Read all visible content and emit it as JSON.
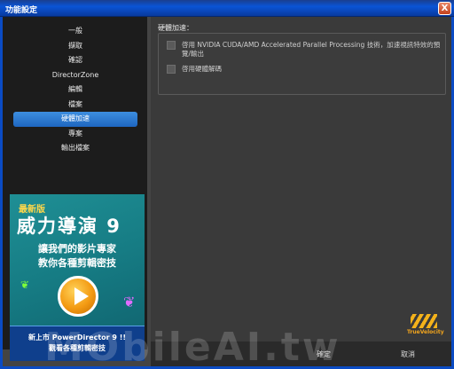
{
  "window": {
    "title": "功能設定",
    "close_glyph": "X"
  },
  "sidebar": {
    "items": [
      {
        "label": "一般",
        "active": false
      },
      {
        "label": "擷取",
        "active": false
      },
      {
        "label": "確認",
        "active": false
      },
      {
        "label": "DirectorZone",
        "active": false
      },
      {
        "label": "編輯",
        "active": false
      },
      {
        "label": "檔案",
        "active": false
      },
      {
        "label": "硬體加速",
        "active": true
      },
      {
        "label": "專案",
        "active": false
      },
      {
        "label": "輸出檔案",
        "active": false
      }
    ]
  },
  "ad": {
    "badge": "最新版",
    "brand": "威力導演 9",
    "line1": "讓我們的影片專家",
    "line2": "教你各種剪輯密技",
    "footer1": "新上市 PowerDirector 9 !!",
    "footer2": "觀看各種剪輯密技"
  },
  "main": {
    "section_title": "硬體加速：",
    "options": [
      {
        "label_line1": "啓用 NVIDIA CUDA/AMD Accelerated Parallel Processing 技術，加速視訊特效的預",
        "label_line2": "覽/輸出",
        "checked": false
      },
      {
        "label_line1": "啓用硬體解碼",
        "label_line2": "",
        "checked": false
      }
    ]
  },
  "logo": {
    "text": "TrueVelocity"
  },
  "buttons": {
    "ok": "確定",
    "cancel": "取消"
  },
  "watermark": "MObileAI.tw",
  "colors": {
    "titlebar": "#0a54d6",
    "active_nav": "#2a7ad4",
    "ad_bg": "#167c84",
    "logo": "#f4b21a"
  }
}
